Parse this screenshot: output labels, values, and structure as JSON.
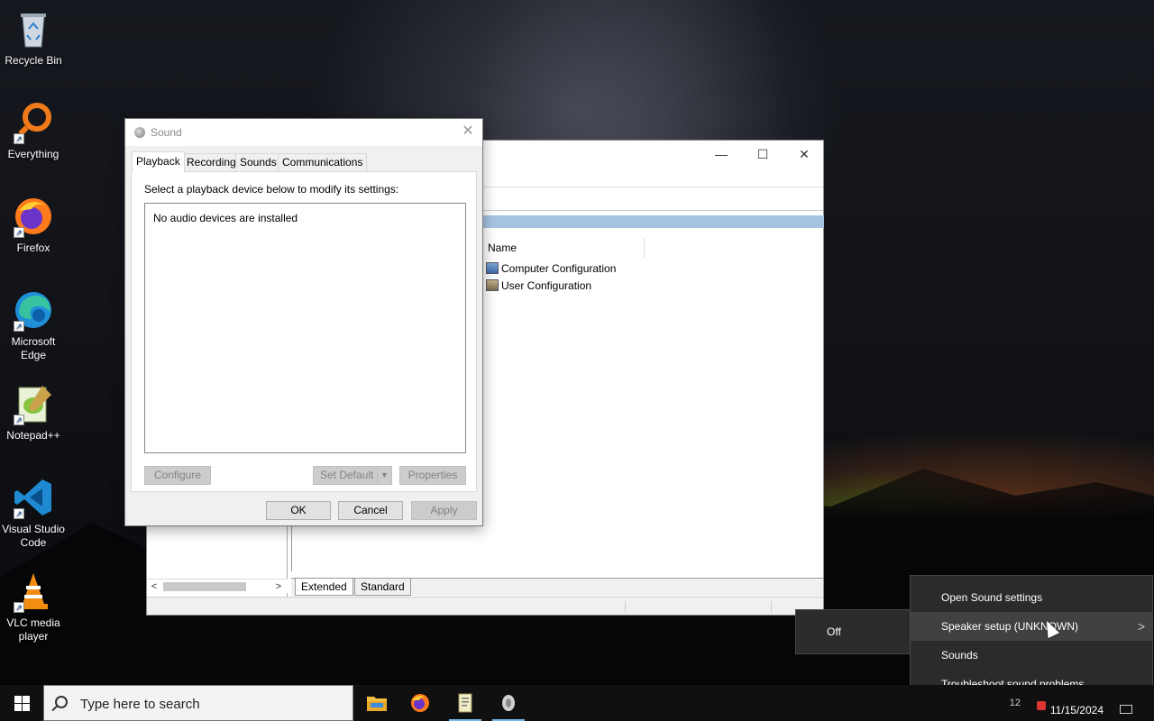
{
  "desktop": {
    "icons": [
      {
        "label": "Recycle Bin",
        "icon": "recycle-bin-icon"
      },
      {
        "label": "Everything",
        "icon": "everything-search-icon"
      },
      {
        "label": "Firefox",
        "icon": "firefox-icon"
      },
      {
        "label": "Microsoft Edge",
        "icon": "edge-icon"
      },
      {
        "label": "Notepad++",
        "icon": "notepad-plus-plus-icon"
      },
      {
        "label": "Visual Studio Code",
        "icon": "vscode-icon"
      },
      {
        "label": "VLC media player",
        "icon": "vlc-icon"
      }
    ]
  },
  "bg_window": {
    "caption": {
      "minimize": "—",
      "maximize": "☐",
      "close": "✕"
    },
    "list": {
      "column_name": "Name",
      "items": [
        "Computer Configuration",
        "User Configuration"
      ]
    },
    "tabs": [
      "Extended",
      "Standard"
    ],
    "scroll": {
      "left": "<",
      "right": ">"
    }
  },
  "sound_dialog": {
    "title": "Sound",
    "close": "✕",
    "tabs": [
      "Playback",
      "Recording",
      "Sounds",
      "Communications"
    ],
    "active_tab": "Playback",
    "instruction": "Select a playback device below to modify its settings:",
    "empty_message": "No audio devices are installed",
    "buttons": {
      "configure": "Configure",
      "set_default": "Set Default",
      "properties": "Properties",
      "ok": "OK",
      "cancel": "Cancel",
      "apply": "Apply"
    }
  },
  "context_menu": {
    "items": [
      "Open Sound settings",
      "Speaker setup (UNKNOWN)",
      "Sounds",
      "Troubleshoot sound problems"
    ],
    "submenu_arrow": ">",
    "submenu": {
      "items": [
        "Off"
      ]
    }
  },
  "taskbar": {
    "search_placeholder": "Type here to search",
    "apps": [
      "file-explorer-icon",
      "firefox-icon",
      "notepad-plus-plus-icon",
      "sound-icon"
    ],
    "tray": {
      "date": "11/15/2024",
      "misc": "12"
    }
  },
  "colors": {
    "menu_bg": "#2b2b2b",
    "menu_hover": "#414141",
    "taskbar_bg": "#101010",
    "accent": "#76b9ed"
  }
}
